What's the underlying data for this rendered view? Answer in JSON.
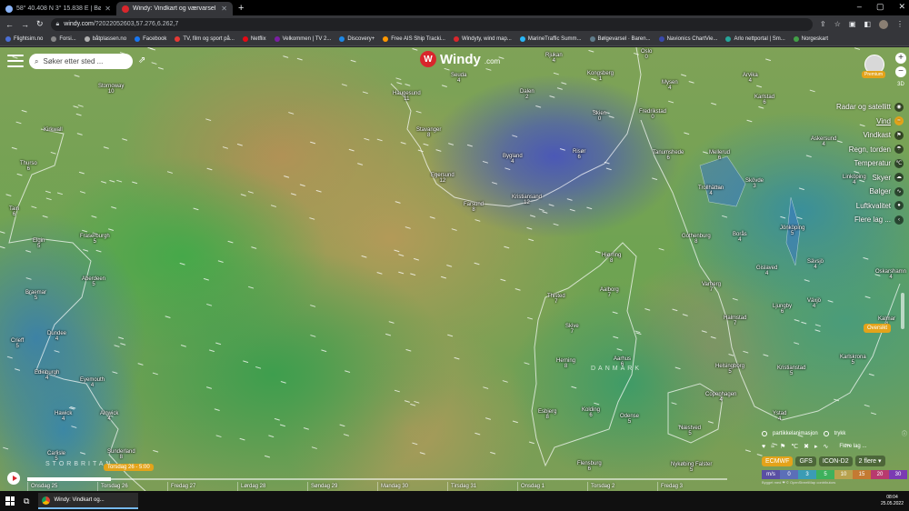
{
  "browser": {
    "tabs": [
      {
        "label": "58° 40.408 N 3° 15.838 E | Bølge...",
        "active": false,
        "color": "#8ab4f8"
      },
      {
        "label": "Windy: Vindkart og værvarsel",
        "active": true,
        "color": "#d9262c"
      }
    ],
    "new_tab": "+",
    "window_controls": [
      "–",
      "▢",
      "✕"
    ],
    "url_host": "windy.com",
    "url_path": "/?2022052603,57.276,6.262,7",
    "bookmarks": [
      {
        "label": "Flightsim.no",
        "color": "#4b6fd6"
      },
      {
        "label": "Forsi...",
        "color": "#888888"
      },
      {
        "label": "båtplassen.no",
        "color": "#b0b0b0"
      },
      {
        "label": "Facebook",
        "color": "#1877f2"
      },
      {
        "label": "TV, film og sport på...",
        "color": "#e53935"
      },
      {
        "label": "Netflix",
        "color": "#e50914"
      },
      {
        "label": "Velkommen | TV 2...",
        "color": "#7b1fa2"
      },
      {
        "label": "Discovery+",
        "color": "#1e88e5"
      },
      {
        "label": "Free AIS Ship Tracki...",
        "color": "#ff9800"
      },
      {
        "label": "Windyty, wind map...",
        "color": "#d9262c"
      },
      {
        "label": "MarineTraffic Summ...",
        "color": "#29b6f6"
      },
      {
        "label": "Bølgevarsel · Baren...",
        "color": "#607d8b"
      },
      {
        "label": "Navionics ChartVie...",
        "color": "#3949ab"
      },
      {
        "label": "Arlo nettportal | Sm...",
        "color": "#26a69a"
      },
      {
        "label": "Norgeskart",
        "color": "#43a047"
      }
    ]
  },
  "map": {
    "search_placeholder": "Søker etter sted ...",
    "brand": "Windy",
    "brand_suffix": ".com",
    "premium_label": "Premium",
    "zoom_plus": "+",
    "zoom_minus": "−",
    "zoom_3d": "3D",
    "overview_button": "Oversikt",
    "country_labels": [
      "DANMARK",
      "STORBRITAN"
    ],
    "places": [
      {
        "name": "Stornoway",
        "val": "10"
      },
      {
        "name": "Kirkwall",
        "val": ""
      },
      {
        "name": "Thurso",
        "val": "6"
      },
      {
        "name": "Tain",
        "val": "6"
      },
      {
        "name": "Fraserburgh",
        "val": "5"
      },
      {
        "name": "Elgin",
        "val": "5"
      },
      {
        "name": "Aberdeen",
        "val": "5"
      },
      {
        "name": "Braemar",
        "val": "5"
      },
      {
        "name": "Dundee",
        "val": "4"
      },
      {
        "name": "Crieff",
        "val": "5"
      },
      {
        "name": "Edinburgh",
        "val": "4"
      },
      {
        "name": "Eyemouth",
        "val": "4"
      },
      {
        "name": "Hawick",
        "val": "4"
      },
      {
        "name": "Alnwick",
        "val": "4"
      },
      {
        "name": "Carlisle",
        "val": "5"
      },
      {
        "name": "Sunderland",
        "val": "8"
      },
      {
        "name": "Haugesund",
        "val": "11"
      },
      {
        "name": "Stavanger",
        "val": "8"
      },
      {
        "name": "Egersund",
        "val": "12"
      },
      {
        "name": "Farsund",
        "val": "8"
      },
      {
        "name": "Kristiansand",
        "val": "12"
      },
      {
        "name": "Seuda",
        "val": "4"
      },
      {
        "name": "Dalen",
        "val": "2"
      },
      {
        "name": "Bygland",
        "val": "4"
      },
      {
        "name": "Risør",
        "val": "6"
      },
      {
        "name": "Rjukan",
        "val": "4"
      },
      {
        "name": "Kongsberg",
        "val": "1"
      },
      {
        "name": "Skien",
        "val": "0"
      },
      {
        "name": "Oslo",
        "val": "0"
      },
      {
        "name": "Mysen",
        "val": "4"
      },
      {
        "name": "Fredrikstad",
        "val": "0"
      },
      {
        "name": "Tanumshede",
        "val": "6"
      },
      {
        "name": "Arvika",
        "val": "4"
      },
      {
        "name": "Karlstad",
        "val": "6"
      },
      {
        "name": "Mellerud",
        "val": "6"
      },
      {
        "name": "Trollhättan",
        "val": "4"
      },
      {
        "name": "Skövde",
        "val": "3"
      },
      {
        "name": "Askersund",
        "val": "4"
      },
      {
        "name": "Linköping",
        "val": "4"
      },
      {
        "name": "Gothenburg",
        "val": "8"
      },
      {
        "name": "Borås",
        "val": "4"
      },
      {
        "name": "Jönköping",
        "val": "5"
      },
      {
        "name": "Hjørring",
        "val": "8"
      },
      {
        "name": "Thisted",
        "val": "7"
      },
      {
        "name": "Aalborg",
        "val": "7"
      },
      {
        "name": "Skive",
        "val": "7"
      },
      {
        "name": "Herning",
        "val": "8"
      },
      {
        "name": "Aarhus",
        "val": "6"
      },
      {
        "name": "Varberg",
        "val": "7"
      },
      {
        "name": "Gislaved",
        "val": "4"
      },
      {
        "name": "Sävsjö",
        "val": "4"
      },
      {
        "name": "Halmstad",
        "val": "7"
      },
      {
        "name": "Ljungby",
        "val": "6"
      },
      {
        "name": "Växjö",
        "val": "4"
      },
      {
        "name": "Oskarshamn",
        "val": "4"
      },
      {
        "name": "Kalmar",
        "val": "4"
      },
      {
        "name": "Esbjerg",
        "val": "8"
      },
      {
        "name": "Kolding",
        "val": "6"
      },
      {
        "name": "Odense",
        "val": "5"
      },
      {
        "name": "Helsingborg",
        "val": "5"
      },
      {
        "name": "Kristianstad",
        "val": "5"
      },
      {
        "name": "Karlskrona",
        "val": "5"
      },
      {
        "name": "Copenhagen",
        "val": "4"
      },
      {
        "name": "Næstved",
        "val": "5"
      },
      {
        "name": "Ystad",
        "val": "4"
      },
      {
        "name": "Flensburg",
        "val": "6"
      },
      {
        "name": "Nykøbing Falster",
        "val": "5"
      }
    ]
  },
  "layers": [
    {
      "label": "Radar og satellitt",
      "icon": "radar-icon",
      "glyph": "◉",
      "active": false
    },
    {
      "label": "Vind",
      "icon": "wind-icon",
      "glyph": "≈",
      "active": true
    },
    {
      "label": "Vindkast",
      "icon": "gust-icon",
      "glyph": "⚑",
      "active": false
    },
    {
      "label": "Regn, torden",
      "icon": "rain-icon",
      "glyph": "☂",
      "active": false
    },
    {
      "label": "Temperatur",
      "icon": "thermometer-icon",
      "glyph": "℃",
      "active": false
    },
    {
      "label": "Skyer",
      "icon": "cloud-icon",
      "glyph": "☁",
      "active": false
    },
    {
      "label": "Bølger",
      "icon": "waves-icon",
      "glyph": "∿",
      "active": false
    },
    {
      "label": "Luftkvalitet",
      "icon": "air-quality-icon",
      "glyph": "●",
      "active": false
    },
    {
      "label": "Flere lag ...",
      "icon": "more-layers-icon",
      "glyph": "‹",
      "active": false
    }
  ],
  "bottom_panel": {
    "options": [
      "partikkelanimasjon",
      "trykk"
    ],
    "more_layers": "Flere lag ...",
    "models": [
      {
        "label": "ECMWF",
        "active": true
      },
      {
        "label": "GFS",
        "active": false
      },
      {
        "label": "ICON-D2",
        "active": false
      },
      {
        "label": "2 flere ▾",
        "active": false
      }
    ],
    "scale": [
      {
        "label": "m/s",
        "color": "#5a4fa3"
      },
      {
        "label": "0",
        "color": "#5b6fb8"
      },
      {
        "label": "3",
        "color": "#3b9cb5"
      },
      {
        "label": "5",
        "color": "#3eb15c"
      },
      {
        "label": "10",
        "color": "#b8a24e"
      },
      {
        "label": "15",
        "color": "#c47a32"
      },
      {
        "label": "20",
        "color": "#b83a6e"
      },
      {
        "label": "30",
        "color": "#7b3bb3"
      }
    ],
    "copyright": "Bygget med ❤ © OpenStreetMap contributors"
  },
  "timeline": {
    "current": "Torsdag 26 - 5:00",
    "progress": 0.12,
    "days": [
      "Onsdag 25",
      "Torsdag 26",
      "Fredag 27",
      "Lørdag 28",
      "Søndag 29",
      "Mandag 30",
      "Tirsdag 31",
      "Onsdag 1",
      "Torsdag 2",
      "Fredag 3"
    ]
  },
  "taskbar": {
    "app_label": "Windy: Vindkart og...",
    "time": "08:04",
    "date": "25.05.2022"
  }
}
